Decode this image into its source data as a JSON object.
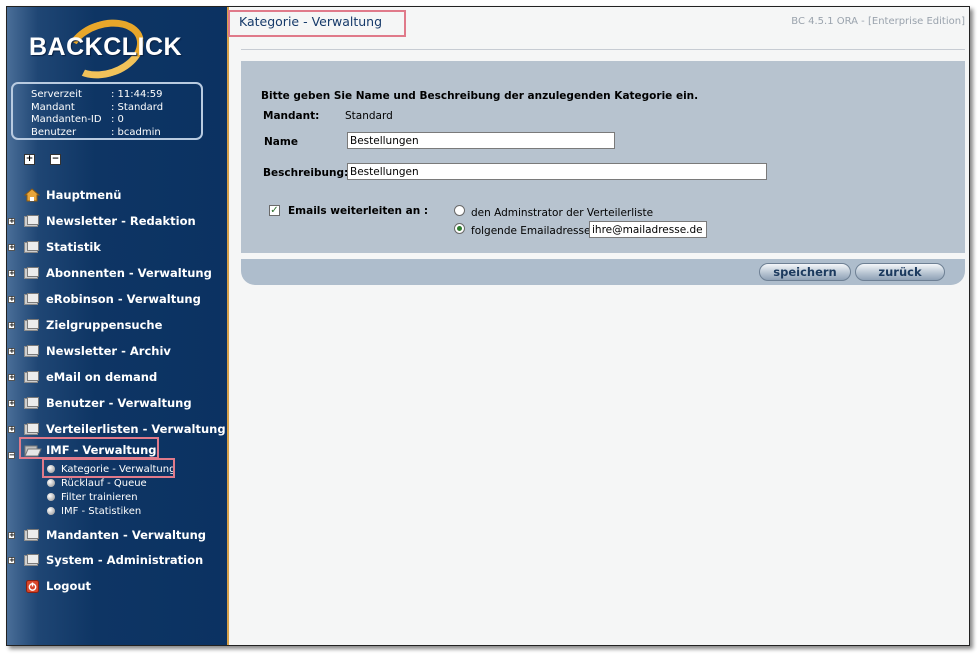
{
  "app": {
    "logo_text": "BACKCLICK",
    "version": "BC 4.5.1 ORA - [Enterprise Edition]"
  },
  "server_info": [
    {
      "key": "Serverzeit",
      "value": ": 11:44:59"
    },
    {
      "key": "Mandant",
      "value": ": Standard"
    },
    {
      "key": "Mandanten-ID",
      "value": ": 0"
    },
    {
      "key": "Benutzer",
      "value": ": bcadmin"
    }
  ],
  "tree_controls": {
    "expand": "+",
    "collapse": "−"
  },
  "menu": {
    "main": "Hauptmenü",
    "items": [
      "Newsletter - Redaktion",
      "Statistik",
      "Abonnenten - Verwaltung",
      "eRobinson - Verwaltung",
      "Zielgruppensuche",
      "Newsletter - Archiv",
      "eMail on demand",
      "Benutzer - Verwaltung",
      "Verteilerlisten - Verwaltung",
      "IMF - Verwaltung"
    ],
    "sub_items": [
      "Kategorie - Verwaltung",
      "Rücklauf - Queue",
      "Filter trainieren",
      "IMF - Statistiken"
    ],
    "items_after": [
      "Mandanten - Verwaltung",
      "System - Administration"
    ],
    "logout": "Logout"
  },
  "page": {
    "title": "Kategorie - Verwaltung",
    "instruction": "Bitte geben Sie Name und Beschreibung der anzulegenden Kategorie ein.",
    "mandant_label": "Mandant:",
    "mandant_value": "Standard",
    "name_label": "Name",
    "name_value": "Bestellungen",
    "description_label": "Beschreibung:",
    "description_value": "Bestellungen",
    "forward_label": "Emails weiterleiten an :",
    "forward_checked": true,
    "option_admin": "den Adminstrator der Verteilerliste",
    "option_address": "folgende Emailadresse :",
    "email_value": "ihre@mailadresse.de"
  },
  "buttons": {
    "save": "speichern",
    "back": "zurück"
  },
  "colors": {
    "sidebar": "#0b3262",
    "accent": "#e8a72a",
    "highlight": "#e07a8a",
    "panel": "#b7c3cf"
  }
}
